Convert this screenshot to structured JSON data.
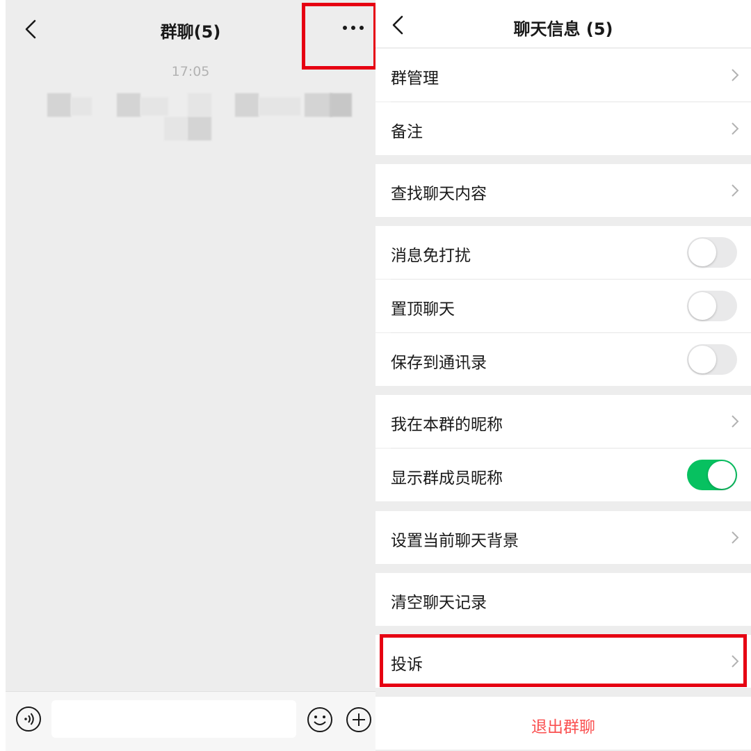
{
  "left": {
    "title": "群聊(5)",
    "timestamp": "17:05",
    "input_placeholder": ""
  },
  "right": {
    "title": "聊天信息 (5)",
    "items": {
      "group_manage": "群管理",
      "remark": "备注",
      "search_chat": "查找聊天内容",
      "mute": "消息免打扰",
      "pin": "置顶聊天",
      "save_contacts": "保存到通讯录",
      "my_nickname": "我在本群的昵称",
      "show_nicknames": "显示群成员昵称",
      "background": "设置当前聊天背景",
      "clear_history": "清空聊天记录",
      "complaint": "投诉",
      "exit_group": "退出群聊"
    },
    "toggles": {
      "mute": false,
      "pin": false,
      "save_contacts": false,
      "show_nicknames": true
    }
  },
  "colors": {
    "accent_green": "#07c160",
    "danger_red": "#fa5151",
    "highlight_red": "#e60012"
  },
  "icons": [
    "back-icon",
    "more-icon",
    "voice-icon",
    "emoji-icon",
    "plus-icon",
    "chevron-right-icon"
  ]
}
